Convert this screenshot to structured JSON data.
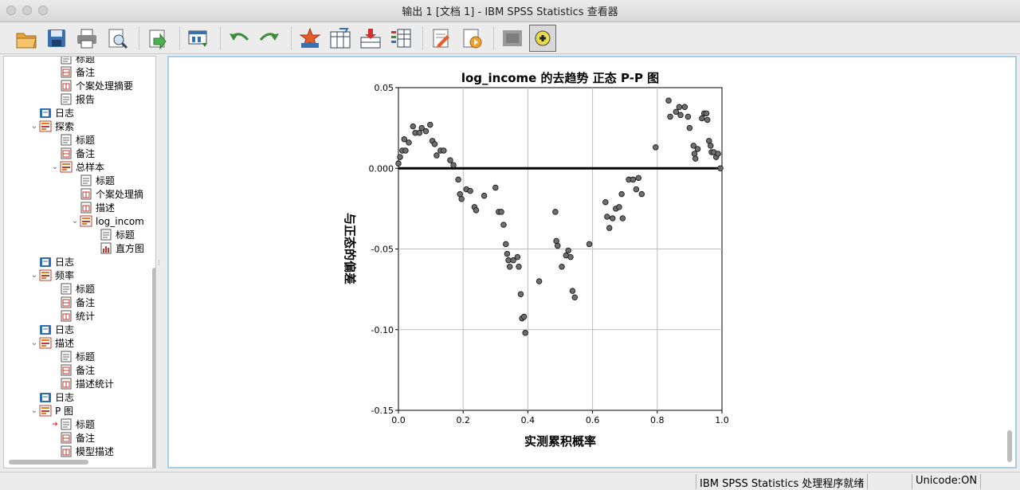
{
  "window": {
    "title": "输出 1 [文档 1] - IBM SPSS Statistics 查看器"
  },
  "toolbar": {
    "buttons": [
      "open-icon",
      "save-icon",
      "print-icon",
      "print-preview-icon",
      "export-icon",
      "recall-dialog-icon",
      "undo-icon",
      "redo-icon",
      "goto-case-icon",
      "goto-variable-icon",
      "insert-cases-icon",
      "variables-icon",
      "designate-window-icon",
      "insert-output-icon",
      "hide-icon",
      "add-icon"
    ]
  },
  "nav": {
    "items": [
      {
        "label": "标题",
        "level": 2,
        "icon": "title-icon",
        "partial": true
      },
      {
        "label": "备注",
        "level": 2,
        "icon": "notes-icon"
      },
      {
        "label": "个案处理摘要",
        "level": 2,
        "icon": "table-icon"
      },
      {
        "label": "报告",
        "level": 2,
        "icon": "title-icon"
      },
      {
        "label": "日志",
        "level": 1,
        "icon": "log-icon"
      },
      {
        "label": "探索",
        "level": 1,
        "icon": "folder-icon",
        "open": true
      },
      {
        "label": "标题",
        "level": 2,
        "icon": "title-icon"
      },
      {
        "label": "备注",
        "level": 2,
        "icon": "notes-icon"
      },
      {
        "label": "总样本",
        "level": 2,
        "icon": "folder-icon",
        "open": true
      },
      {
        "label": "标题",
        "level": 3,
        "icon": "title-icon"
      },
      {
        "label": "个案处理摘",
        "level": 3,
        "icon": "table-icon"
      },
      {
        "label": "描述",
        "level": 3,
        "icon": "table-icon"
      },
      {
        "label": "log_incom",
        "level": 3,
        "icon": "folder-icon",
        "open": true
      },
      {
        "label": "标题",
        "level": 4,
        "icon": "title-icon"
      },
      {
        "label": "直方图",
        "level": 4,
        "icon": "chart-icon"
      },
      {
        "label": "日志",
        "level": 1,
        "icon": "log-icon"
      },
      {
        "label": "频率",
        "level": 1,
        "icon": "folder-icon",
        "open": true
      },
      {
        "label": "标题",
        "level": 2,
        "icon": "title-icon"
      },
      {
        "label": "备注",
        "level": 2,
        "icon": "notes-icon"
      },
      {
        "label": "统计",
        "level": 2,
        "icon": "table-icon"
      },
      {
        "label": "日志",
        "level": 1,
        "icon": "log-icon"
      },
      {
        "label": "描述",
        "level": 1,
        "icon": "folder-icon",
        "open": true
      },
      {
        "label": "标题",
        "level": 2,
        "icon": "title-icon"
      },
      {
        "label": "备注",
        "level": 2,
        "icon": "notes-icon"
      },
      {
        "label": "描述统计",
        "level": 2,
        "icon": "table-icon"
      },
      {
        "label": "日志",
        "level": 1,
        "icon": "log-icon"
      },
      {
        "label": "P 图",
        "level": 1,
        "icon": "folder-icon",
        "open": true
      },
      {
        "label": "标题",
        "level": 2,
        "icon": "title-icon",
        "current": true
      },
      {
        "label": "备注",
        "level": 2,
        "icon": "notes-icon"
      },
      {
        "label": "模型描述",
        "level": 2,
        "icon": "table-icon"
      }
    ]
  },
  "chart_data": {
    "type": "scatter",
    "title": "log_income 的去趋势 正态 P-P 图",
    "xlabel": "实测累积概率",
    "ylabel": "与正态的偏差",
    "xlim": [
      0.0,
      1.0
    ],
    "ylim": [
      -0.15,
      0.05
    ],
    "xticks": [
      "0.0",
      "0.2",
      "0.4",
      "0.6",
      "0.8",
      "1.0"
    ],
    "yticks": [
      "0.05",
      "0.000",
      "-0.05",
      "-0.10",
      "-0.15"
    ],
    "ytick_values": [
      0.05,
      0.0,
      -0.05,
      -0.1,
      -0.15
    ],
    "reference_line": 0.0,
    "grid": true,
    "points": [
      [
        0.0,
        0.003
      ],
      [
        0.005,
        0.007
      ],
      [
        0.012,
        0.011
      ],
      [
        0.018,
        0.018
      ],
      [
        0.022,
        0.011
      ],
      [
        0.032,
        0.016
      ],
      [
        0.045,
        0.026
      ],
      [
        0.052,
        0.022
      ],
      [
        0.065,
        0.022
      ],
      [
        0.072,
        0.025
      ],
      [
        0.085,
        0.023
      ],
      [
        0.098,
        0.027
      ],
      [
        0.105,
        0.017
      ],
      [
        0.112,
        0.015
      ],
      [
        0.118,
        0.008
      ],
      [
        0.13,
        0.011
      ],
      [
        0.14,
        0.011
      ],
      [
        0.16,
        0.005
      ],
      [
        0.17,
        0.002
      ],
      [
        0.185,
        -0.007
      ],
      [
        0.19,
        -0.016
      ],
      [
        0.195,
        -0.019
      ],
      [
        0.21,
        -0.013
      ],
      [
        0.222,
        -0.014
      ],
      [
        0.235,
        -0.024
      ],
      [
        0.24,
        -0.026
      ],
      [
        0.265,
        -0.017
      ],
      [
        0.3,
        -0.012
      ],
      [
        0.31,
        -0.027
      ],
      [
        0.318,
        -0.027
      ],
      [
        0.325,
        -0.035
      ],
      [
        0.332,
        -0.047
      ],
      [
        0.336,
        -0.053
      ],
      [
        0.34,
        -0.057
      ],
      [
        0.344,
        -0.061
      ],
      [
        0.355,
        -0.057
      ],
      [
        0.368,
        -0.055
      ],
      [
        0.372,
        -0.061
      ],
      [
        0.378,
        -0.078
      ],
      [
        0.382,
        -0.093
      ],
      [
        0.388,
        -0.092
      ],
      [
        0.392,
        -0.102
      ],
      [
        0.435,
        -0.07
      ],
      [
        0.485,
        -0.027
      ],
      [
        0.488,
        -0.045
      ],
      [
        0.492,
        -0.048
      ],
      [
        0.505,
        -0.061
      ],
      [
        0.518,
        -0.054
      ],
      [
        0.525,
        -0.051
      ],
      [
        0.532,
        -0.055
      ],
      [
        0.538,
        -0.076
      ],
      [
        0.545,
        -0.08
      ],
      [
        0.59,
        -0.047
      ],
      [
        0.64,
        -0.021
      ],
      [
        0.645,
        -0.03
      ],
      [
        0.652,
        -0.037
      ],
      [
        0.662,
        -0.031
      ],
      [
        0.672,
        -0.025
      ],
      [
        0.682,
        -0.024
      ],
      [
        0.69,
        -0.016
      ],
      [
        0.693,
        -0.031
      ],
      [
        0.712,
        -0.007
      ],
      [
        0.725,
        -0.007
      ],
      [
        0.735,
        -0.013
      ],
      [
        0.742,
        -0.006
      ],
      [
        0.752,
        -0.016
      ],
      [
        0.795,
        0.013
      ],
      [
        0.835,
        0.042
      ],
      [
        0.84,
        0.032
      ],
      [
        0.858,
        0.035
      ],
      [
        0.868,
        0.038
      ],
      [
        0.872,
        0.033
      ],
      [
        0.885,
        0.038
      ],
      [
        0.895,
        0.032
      ],
      [
        0.9,
        0.025
      ],
      [
        0.912,
        0.014
      ],
      [
        0.915,
        0.009
      ],
      [
        0.918,
        0.006
      ],
      [
        0.925,
        0.012
      ],
      [
        0.938,
        0.031
      ],
      [
        0.945,
        0.034
      ],
      [
        0.952,
        0.034
      ],
      [
        0.955,
        0.03
      ],
      [
        0.96,
        0.017
      ],
      [
        0.965,
        0.014
      ],
      [
        0.968,
        0.01
      ],
      [
        0.975,
        0.01
      ],
      [
        0.982,
        0.007
      ],
      [
        0.988,
        0.009
      ],
      [
        0.995,
        0.0
      ]
    ]
  },
  "status": {
    "processor": "IBM SPSS Statistics 处理程序就绪",
    "unicode": "Unicode:ON"
  }
}
